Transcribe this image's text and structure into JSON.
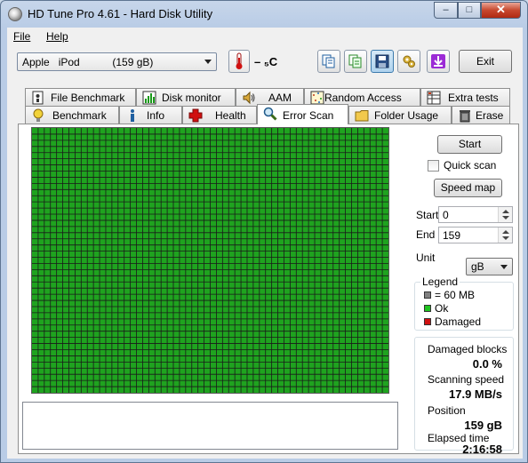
{
  "window": {
    "title": "HD Tune Pro 4.61 - Hard Disk Utility",
    "controls": {
      "minimize": "–",
      "maximize": "□",
      "close": "✕"
    }
  },
  "menu": {
    "file": "File",
    "help": "Help"
  },
  "toolbar": {
    "drive": "Apple   iPod           (159 gB)",
    "temperature": "– ₅C",
    "buttons": [
      "copy-info-icon",
      "copy-text-icon",
      "save-icon",
      "options-icon",
      "download-icon"
    ],
    "exit_label": "Exit"
  },
  "tabs_back": [
    {
      "label": "File Benchmark",
      "icon": "file-benchmark-icon"
    },
    {
      "label": "Disk monitor",
      "icon": "disk-monitor-icon"
    },
    {
      "label": "AAM",
      "icon": "speaker-icon"
    },
    {
      "label": "Random Access",
      "icon": "random-access-icon"
    },
    {
      "label": "Extra tests",
      "icon": "extra-tests-icon"
    }
  ],
  "tabs_front": [
    {
      "label": "Benchmark",
      "icon": "benchmark-icon"
    },
    {
      "label": "Info",
      "icon": "info-icon"
    },
    {
      "label": "Health",
      "icon": "health-icon"
    },
    {
      "label": "Error Scan",
      "icon": "magnifier-icon",
      "selected": true
    },
    {
      "label": "Folder Usage",
      "icon": "folder-icon"
    },
    {
      "label": "Erase",
      "icon": "trash-icon"
    }
  ],
  "scan": {
    "grid_columns": 58,
    "grid_rows": 43,
    "block_status": "ok",
    "colors": {
      "ok": "#1fa31f",
      "damaged": "#d01010",
      "unscanned": "#808080",
      "grid_line": "#1a1a1a"
    }
  },
  "side": {
    "start_button": "Start",
    "quick_scan_label": "Quick scan",
    "quick_scan_checked": false,
    "speed_map_button": "Speed map",
    "start_label": "Start",
    "start_value": "0",
    "end_label": "End",
    "end_value": "159",
    "unit_label": "Unit",
    "unit_value": "gB"
  },
  "legend": {
    "title": "Legend",
    "block_size": "= 60 MB",
    "ok": "Ok",
    "damaged": "Damaged"
  },
  "stats": {
    "damaged_blocks_label": "Damaged blocks",
    "damaged_blocks_value": "0.0 %",
    "scanning_speed_label": "Scanning speed",
    "scanning_speed_value": "17.9 MB/s",
    "position_label": "Position",
    "position_value": "159 gB",
    "elapsed_label": "Elapsed time",
    "elapsed_value": "2:16:58"
  }
}
